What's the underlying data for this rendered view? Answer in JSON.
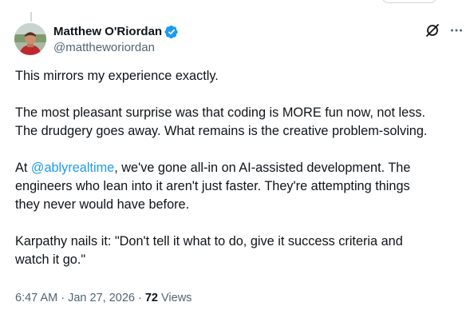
{
  "author": {
    "display_name": "Matthew O'Riordan",
    "handle": "@mattheworiordan",
    "verified": true
  },
  "tweet": {
    "line1": "This mirrors my experience exactly.",
    "para2_line1": "The most pleasant surprise was that coding is MORE fun now, not less.",
    "para2_line2": "The drudgery goes away. What remains is the creative problem-solving.",
    "para3_prefix": "At ",
    "para3_mention": "@ablyrealtime",
    "para3_rest_line1": ", we've gone all-in on AI-assisted development. The",
    "para3_line2": "engineers who lean into it aren't just faster. They're attempting things",
    "para3_line3": "they never would have before.",
    "para4_line1": "Karpathy nails it: \"Don't tell it what to do, give it success criteria and",
    "para4_line2": "watch it go.\""
  },
  "meta": {
    "time": "6:47 AM",
    "separator1": " · ",
    "date": "Jan 27, 2026",
    "separator2": " · ",
    "views_count": "72",
    "views_label": " Views"
  },
  "colors": {
    "accent": "#1d9bf0",
    "text_primary": "#0f1419",
    "text_secondary": "#536471"
  },
  "icons": {
    "verified": "verified-badge-icon",
    "grok": "grok-icon",
    "more": "more-options-icon"
  }
}
